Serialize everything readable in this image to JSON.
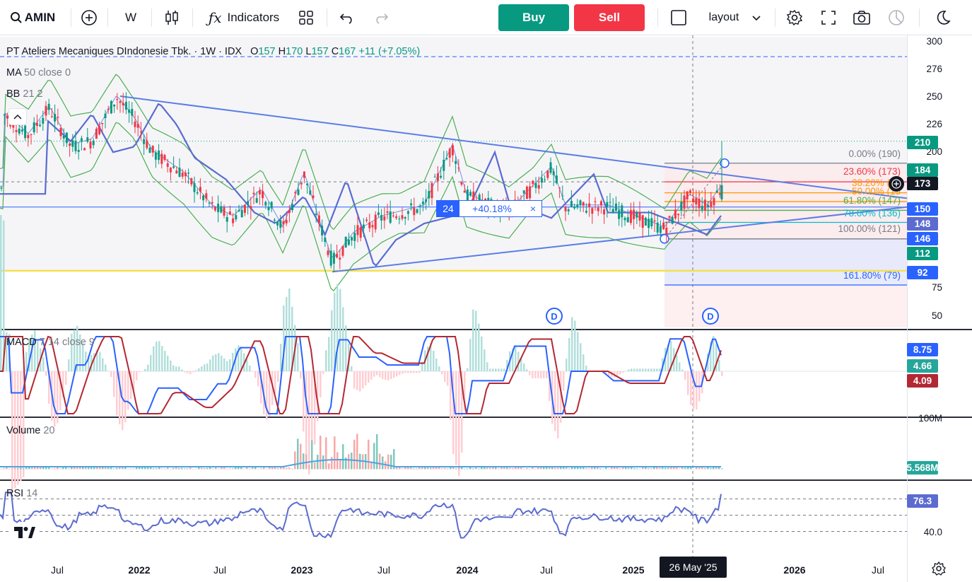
{
  "toolbar": {
    "symbol": "AMIN",
    "interval": "W",
    "indicators_label": "Indicators",
    "buy_label": "Buy",
    "sell_label": "Sell",
    "layout_label": "layout",
    "icons": [
      "search-icon",
      "add-symbol-icon",
      "bar-style-icon",
      "indicators-icon",
      "templates-icon",
      "undo-icon",
      "redo-icon",
      "layout-checkbox-icon",
      "settings-icon",
      "fullscreen-icon",
      "snapshot-icon",
      "replay-icon",
      "theme-icon"
    ]
  },
  "main_pane": {
    "title": "PT Ateliers Mecaniques DIndonesie Tbk. · 1W · IDX",
    "ohlc": {
      "o_label": "O",
      "o": "157",
      "h_label": "H",
      "h": "170",
      "l_label": "L",
      "l": "157",
      "c_label": "C",
      "c": "167",
      "change": "+11 (+7.05%)"
    },
    "ma_label": "MA",
    "ma_params": "50 close 0",
    "bb_label": "BB",
    "bb_params": "21 2",
    "price_scale": [
      "300",
      "276",
      "250",
      "226",
      "200",
      "75",
      "50"
    ],
    "tags": [
      {
        "value": "210",
        "color": "#089981"
      },
      {
        "value": "184",
        "color": "#089981"
      },
      {
        "value": "173",
        "color": "#131722"
      },
      {
        "value": "150",
        "color": "#2962ff"
      },
      {
        "value": "148",
        "color": "#5b6bd0"
      },
      {
        "value": "146",
        "color": "#2962ff"
      },
      {
        "value": "112",
        "color": "#089981"
      },
      {
        "value": "92",
        "color": "#2962ff"
      }
    ],
    "fib_levels": [
      {
        "label": "0.00% (190)",
        "color": "#787b86"
      },
      {
        "label": "23.60% (173)",
        "color": "#f23645"
      },
      {
        "label": "38.20% (16",
        "color": "#ff9800"
      },
      {
        "label": "50.00% (15",
        "color": "#ff9800"
      },
      {
        "label": "61.80% (147)",
        "color": "#4caf50"
      },
      {
        "label": "78.60% (136)",
        "color": "#00bcd4"
      },
      {
        "label": "100.00% (121)",
        "color": "#787b86"
      },
      {
        "label": "161.80% (79)",
        "color": "#2962ff"
      }
    ],
    "measure": {
      "bars": "24",
      "percent": "+40.18%",
      "close": "×"
    },
    "dividend_markers": [
      "D",
      "D"
    ],
    "colors": {
      "up": "#089981",
      "down": "#f23645",
      "ma": "#5b6bd0",
      "bb": "#4caf50",
      "trend": "#5b7ee5",
      "yellow": "#f5e050"
    }
  },
  "macd_pane": {
    "label": "MACD",
    "params": "7 14 close 9",
    "tags": [
      {
        "value": "8.75",
        "color": "#2962ff"
      },
      {
        "value": "4.66",
        "color": "#26a69a"
      },
      {
        "value": "4.09",
        "color": "#b22833"
      }
    ],
    "scale_label": "100M"
  },
  "volume_pane": {
    "label": "Volume",
    "params": "20",
    "tags": [
      {
        "value": "5.568M",
        "color": "#26a69a"
      }
    ]
  },
  "rsi_pane": {
    "label": "RSI",
    "params": "14",
    "tags": [
      {
        "value": "76.3",
        "color": "#5b6bd0"
      }
    ],
    "scale_label": "40.0"
  },
  "time_axis": {
    "labels": [
      "Jul",
      "2022",
      "Jul",
      "2023",
      "Jul",
      "2024",
      "Jul",
      "2025",
      "2026",
      "Jul"
    ],
    "crosshair_date": "26 May '25"
  }
}
